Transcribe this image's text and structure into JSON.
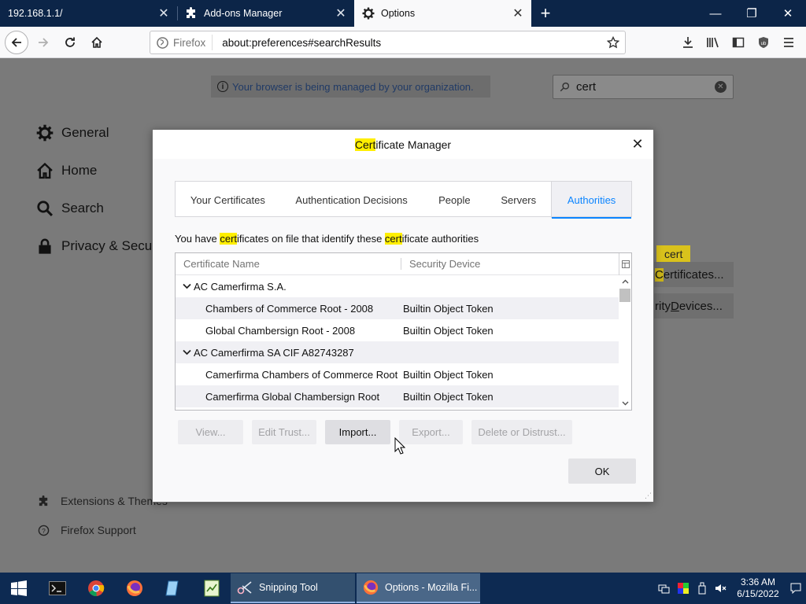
{
  "browser": {
    "tabs": [
      {
        "title": "192.168.1.1/",
        "active": false
      },
      {
        "title": "Add-ons Manager",
        "active": false
      },
      {
        "title": "Options",
        "active": true
      }
    ],
    "identity_label": "Firefox",
    "url": "about:preferences#searchResults"
  },
  "preferences": {
    "managed_notice": "Your browser is being managed by your organization.",
    "search_value": "cert",
    "categories": [
      "General",
      "Home",
      "Search",
      "Privacy & Security"
    ],
    "footer_links": [
      "Extensions & Themes",
      "Firefox Support"
    ],
    "cert_tag": "cert",
    "view_certificates_pre": "",
    "view_certificates_hl": "C",
    "view_certificates_rest": "ertificates...",
    "security_devices_pre": "rity ",
    "security_devices_underline": "D",
    "security_devices_rest": "evices..."
  },
  "dialog": {
    "title_hl": "Cert",
    "title_rest": "ificate Manager",
    "tabs": [
      "Your Certificates",
      "Authentication Decisions",
      "People",
      "Servers",
      "Authorities"
    ],
    "selected_tab": "Authorities",
    "description": {
      "p1": "You have ",
      "hl1": "cert",
      "p2": "ificates on file that identify these ",
      "hl2": "cert",
      "p3": "ificate authorities"
    },
    "columns": [
      "Certificate Name",
      "Security Device"
    ],
    "rows": [
      {
        "type": "group",
        "name": "AC Camerfirma S.A.",
        "device": ""
      },
      {
        "type": "child",
        "name": "Chambers of Commerce Root - 2008",
        "device": "Builtin Object Token"
      },
      {
        "type": "child",
        "name": "Global Chambersign Root - 2008",
        "device": "Builtin Object Token"
      },
      {
        "type": "group",
        "name": "AC Camerfirma SA CIF A82743287",
        "device": ""
      },
      {
        "type": "child",
        "name": "Camerfirma Chambers of Commerce Root",
        "device": "Builtin Object Token"
      },
      {
        "type": "child",
        "name": "Camerfirma Global Chambersign Root",
        "device": "Builtin Object Token"
      }
    ],
    "buttons": {
      "view": "View...",
      "edit_trust": "Edit Trust...",
      "import": "Import...",
      "export": "Export...",
      "delete": "Delete or Distrust..."
    },
    "ok": "OK"
  },
  "taskbar": {
    "apps": [
      "Snipping Tool",
      "Options - Mozilla Fi..."
    ],
    "time": "3:36 AM",
    "date": "6/15/2022"
  }
}
